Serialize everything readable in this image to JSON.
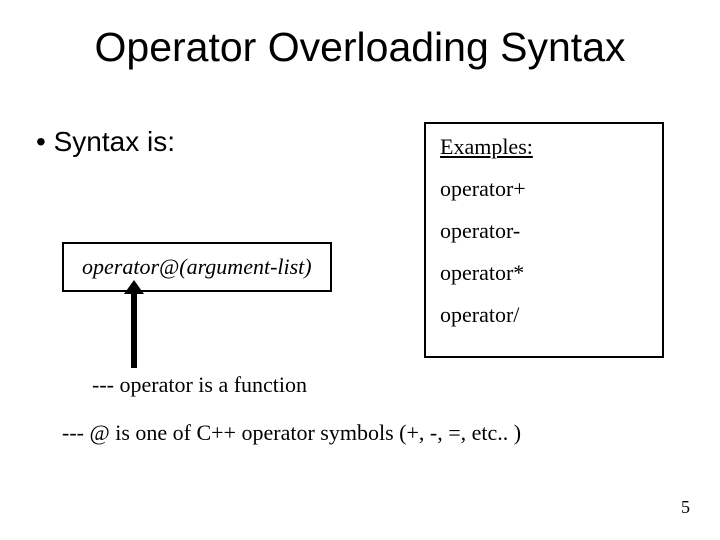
{
  "title": "Operator Overloading Syntax",
  "bullet": "Syntax is:",
  "syntax_box": "operator@(argument-list)",
  "examples": {
    "header": "Examples:",
    "items": [
      "operator+",
      "operator-",
      "operator*",
      "operator/"
    ]
  },
  "note1": "--- operator is a function",
  "note2": "--- @ is one of C++ operator symbols (+, -, =, etc.. )",
  "page_number": "5"
}
